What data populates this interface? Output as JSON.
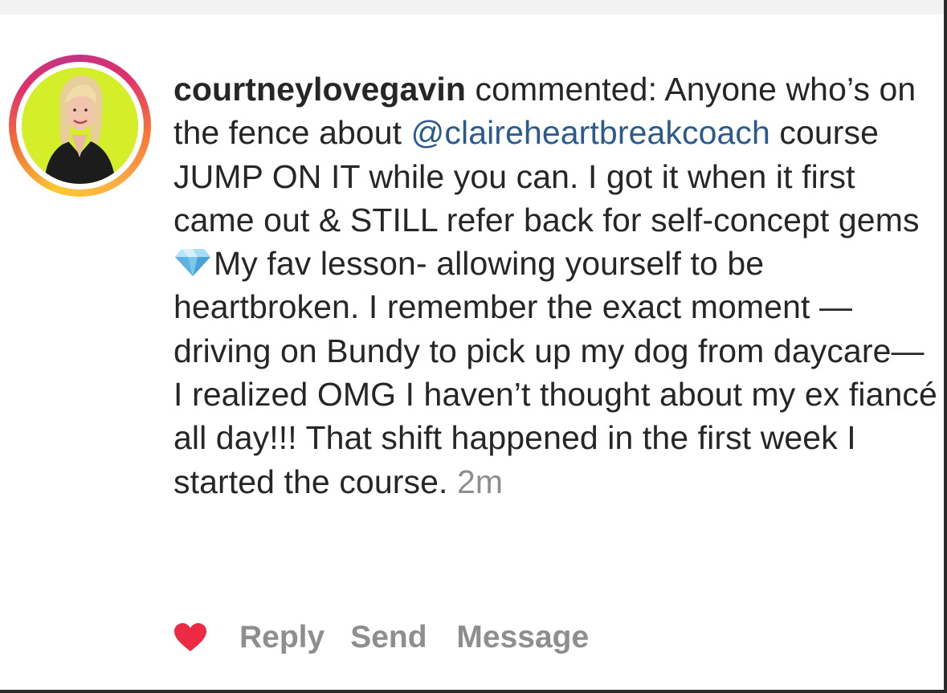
{
  "comment": {
    "username": "courtneylovegavin",
    "verb": " commented: ",
    "text_before_mention": "Anyone who’s on the fence about ",
    "mention": "@claireheartbreakcoach",
    "text_after_mention": " course JUMP ON IT while you can. I got it when it first came out & STILL refer back for self-concept gems",
    "gem_icon": "gem-emoji",
    "text_after_gem": "My fav lesson- allowing yourself to be heartbroken. I remember the exact moment —driving on Bundy to pick up my dog from daycare— I realized OMG I haven’t thought about my ex fiancé all day!!! That shift happened in the first week I started the course. ",
    "timestamp": "2m"
  },
  "actions": {
    "heart_icon": "heart-icon",
    "reply_label": "Reply",
    "send_label": "Send",
    "message_label": "Message"
  },
  "colors": {
    "text": "#262626",
    "mention": "#2b5a8f",
    "muted": "#8e8e8e",
    "heart": "#ed2a44",
    "avatar_bg": "#d4ef2a"
  }
}
